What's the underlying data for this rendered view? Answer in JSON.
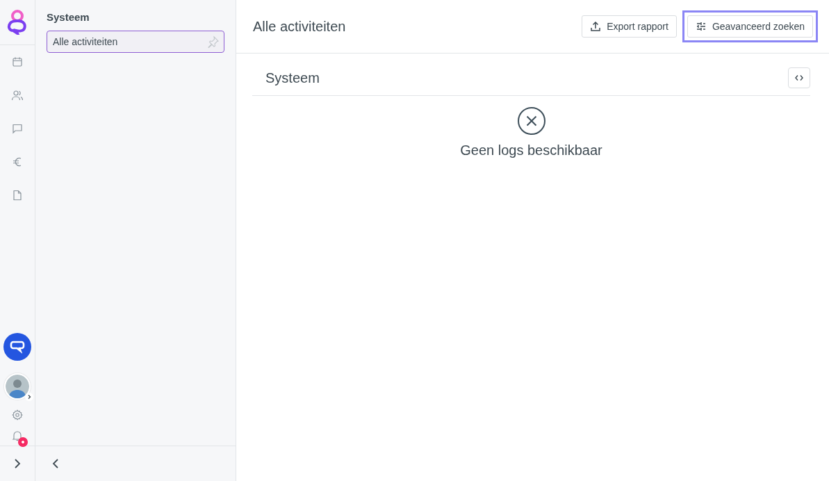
{
  "rail": {
    "items": [
      {
        "kind": "calendar"
      },
      {
        "kind": "people"
      },
      {
        "kind": "chat"
      },
      {
        "kind": "euro"
      },
      {
        "kind": "document"
      }
    ],
    "bell": {
      "unread": true
    }
  },
  "sidebar": {
    "title": "Systeem",
    "items": [
      {
        "label": "Alle activiteiten",
        "selected": true
      }
    ]
  },
  "header": {
    "title": "Alle activiteiten",
    "buttons": [
      {
        "label": "Export rapport",
        "kind": "export",
        "focused": false
      },
      {
        "label": "Geavanceerd zoeken",
        "kind": "filter",
        "focused": true
      }
    ]
  },
  "panel": {
    "title": "Systeem",
    "empty_message": "Geen logs beschikbaar"
  }
}
